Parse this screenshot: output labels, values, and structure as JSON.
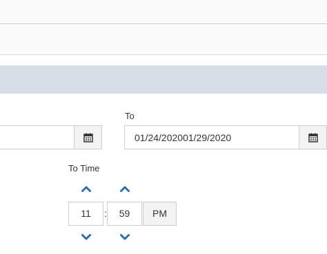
{
  "filters": {
    "to_label": "To",
    "to_date_value": "01/24/202001/29/2020",
    "from_date_value": "",
    "to_time_label": "To Time",
    "to_time": {
      "hour": "11",
      "separator": ":",
      "minute": "59",
      "meridian": "PM"
    }
  },
  "icons": {
    "calendar": "calendar-icon",
    "increment": "chevron-up-icon",
    "decrement": "chevron-down-icon"
  },
  "colors": {
    "header_bar": "#d6dee8",
    "chevron": "#2a6fb0",
    "button_bg": "#f3f3f3",
    "border": "#cccccc"
  }
}
